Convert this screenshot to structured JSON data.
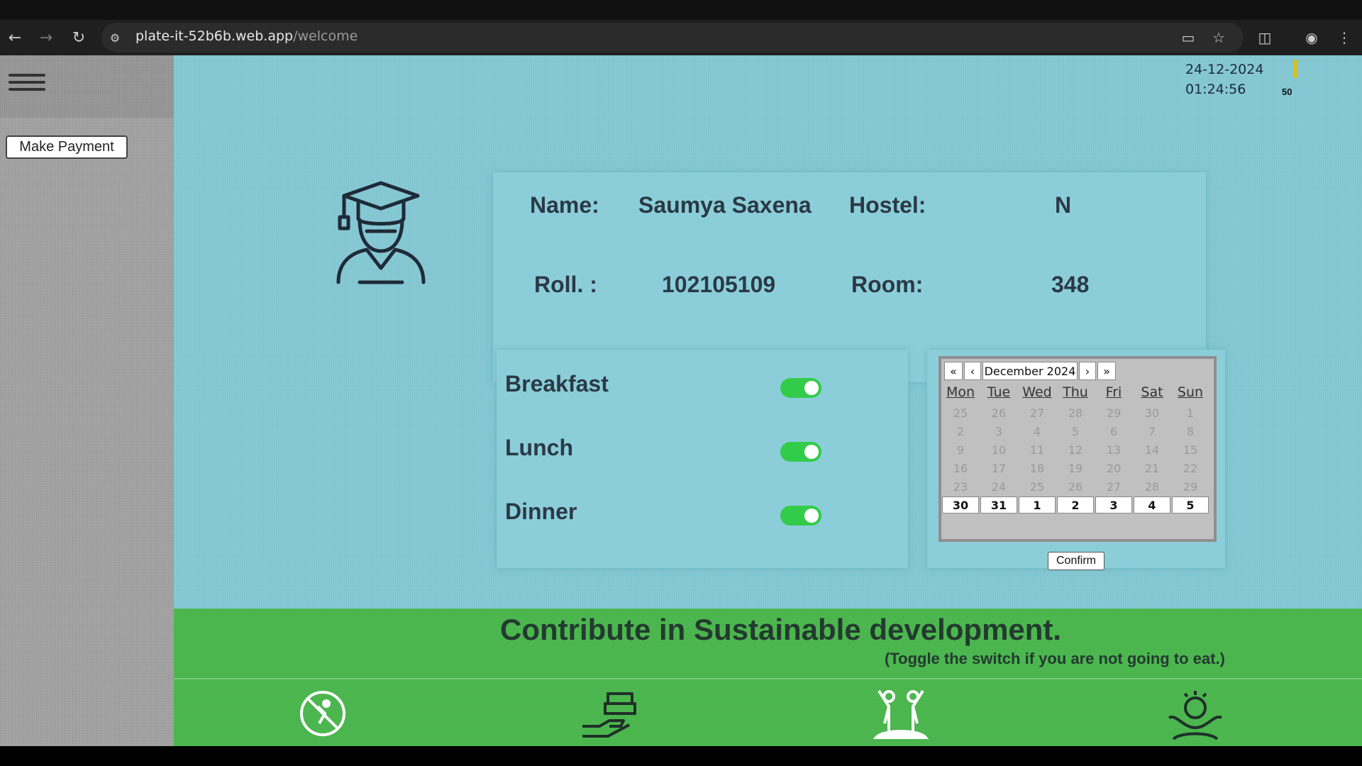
{
  "browser": {
    "url_host": "plate-it-52b6b.web.app",
    "url_path": "/welcome",
    "back_icon": "back-arrow-icon",
    "forward_icon": "forward-arrow-icon",
    "reload_icon": "reload-icon"
  },
  "sidebar": {
    "make_payment_label": "Make Payment"
  },
  "header": {
    "date": "24-12-2024",
    "time": "01:24:56",
    "counter": "50"
  },
  "student": {
    "name_label": "Name:",
    "name_value": "Saumya Saxena",
    "hostel_label": "Hostel:",
    "hostel_value": "N",
    "roll_label": "Roll. :",
    "roll_value": "102105109",
    "room_label": "Room:",
    "room_value": "348"
  },
  "meals": [
    {
      "label": "Breakfast",
      "on": true
    },
    {
      "label": "Lunch",
      "on": true
    },
    {
      "label": "Dinner",
      "on": true
    }
  ],
  "calendar": {
    "prev_year": "«",
    "prev_month": "‹",
    "month_label": "December 2024",
    "next_month": "›",
    "next_year": "»",
    "weekdays": [
      "Mon",
      "Tue",
      "Wed",
      "Thu",
      "Fri",
      "Sat",
      "Sun"
    ],
    "weeks": [
      [
        "25",
        "26",
        "27",
        "28",
        "29",
        "30",
        "1"
      ],
      [
        "2",
        "3",
        "4",
        "5",
        "6",
        "7",
        "8"
      ],
      [
        "9",
        "10",
        "11",
        "12",
        "13",
        "14",
        "15"
      ],
      [
        "16",
        "17",
        "18",
        "19",
        "20",
        "21",
        "22"
      ],
      [
        "23",
        "24",
        "25",
        "26",
        "27",
        "28",
        "29"
      ],
      [
        "30",
        "31",
        "1",
        "2",
        "3",
        "4",
        "5"
      ]
    ],
    "confirm_label": "Confirm"
  },
  "banner": {
    "title": "Contribute in Sustainable development.",
    "subtitle": "(Toggle the switch if you are not going to eat.)"
  },
  "colors": {
    "main_bg": "#84c8d4",
    "banner_bg": "#4cb84f",
    "toggle_on": "#33cc4a"
  }
}
